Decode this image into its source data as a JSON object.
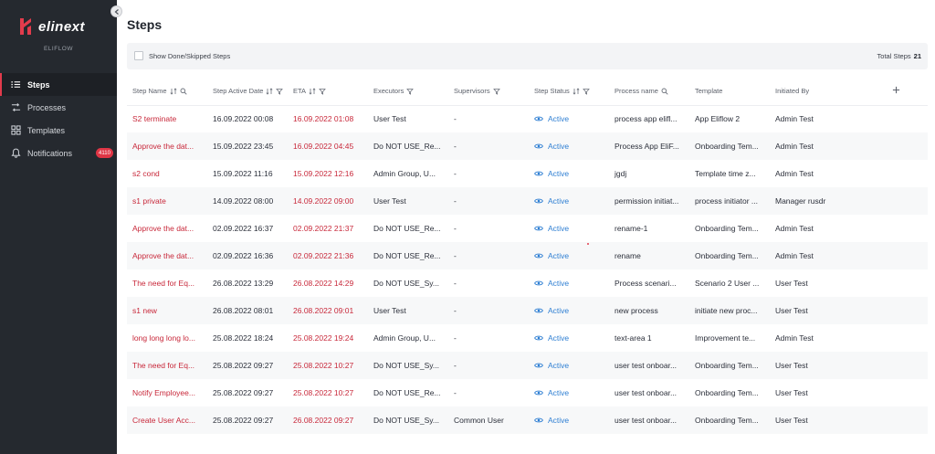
{
  "sidebar": {
    "logo_text": "elinext",
    "product": "ELIFLOW",
    "items": [
      {
        "label": "Steps",
        "icon": "list-icon",
        "active": true
      },
      {
        "label": "Processes",
        "icon": "process-icon"
      },
      {
        "label": "Templates",
        "icon": "grid-icon"
      },
      {
        "label": "Notifications",
        "icon": "bell-icon",
        "badge": "4110"
      }
    ]
  },
  "page": {
    "title": "Steps"
  },
  "filter": {
    "show_done_label": "Show Done/Skipped Steps",
    "total_label": "Total Steps",
    "total_value": "21"
  },
  "colors": {
    "accent": "#e23b4c",
    "sidebar_bg": "#25292f",
    "link_red": "#c8283a",
    "status_blue": "#2f7fd3"
  },
  "table": {
    "headers": [
      "Step Name",
      "Step Active Date",
      "ETA",
      "Executors",
      "Supervisors",
      "Step Status",
      "Process name",
      "Template",
      "Initiated By"
    ],
    "rows": [
      [
        "S2 terminate",
        "16.09.2022 00:08",
        "16.09.2022 01:08",
        "User Test",
        "-",
        "Active",
        "process app elifl...",
        "App Eliflow 2",
        "Admin Test"
      ],
      [
        "Approve the dat...",
        "15.09.2022 23:45",
        "16.09.2022 04:45",
        "Do NOT USE_Re...",
        "-",
        "Active",
        "Process App EliF...",
        "Onboarding Tem...",
        "Admin Test"
      ],
      [
        "s2 cond",
        "15.09.2022 11:16",
        "15.09.2022 12:16",
        "Admin Group, U...",
        "-",
        "Active",
        "jgdj",
        "Template time z...",
        "Admin Test"
      ],
      [
        "s1 private",
        "14.09.2022 08:00",
        "14.09.2022 09:00",
        "User Test",
        "-",
        "Active",
        "permission initiat...",
        "process initiator ...",
        "Manager rusdr"
      ],
      [
        "Approve the dat...",
        "02.09.2022 16:37",
        "02.09.2022 21:37",
        "Do NOT USE_Re...",
        "-",
        "Active",
        "rename-1",
        "Onboarding Tem...",
        "Admin Test"
      ],
      [
        "Approve the dat...",
        "02.09.2022 16:36",
        "02.09.2022 21:36",
        "Do NOT USE_Re...",
        "-",
        "Active",
        "rename",
        "Onboarding Tem...",
        "Admin Test"
      ],
      [
        "The need for Eq...",
        "26.08.2022 13:29",
        "26.08.2022 14:29",
        "Do NOT USE_Sy...",
        "-",
        "Active",
        "Process scenari...",
        "Scenario 2 User ...",
        "User Test"
      ],
      [
        "s1 new",
        "26.08.2022 08:01",
        "26.08.2022 09:01",
        "User Test",
        "-",
        "Active",
        "new process",
        "initiate new proc...",
        "User Test"
      ],
      [
        "long long long lo...",
        "25.08.2022 18:24",
        "25.08.2022 19:24",
        "Admin Group, U...",
        "-",
        "Active",
        "text-area 1",
        "Improvement te...",
        "Admin Test"
      ],
      [
        "The need for Eq...",
        "25.08.2022 09:27",
        "25.08.2022 10:27",
        "Do NOT USE_Sy...",
        "-",
        "Active",
        "user test onboar...",
        "Onboarding Tem...",
        "User Test"
      ],
      [
        "Notify Employee...",
        "25.08.2022 09:27",
        "25.08.2022 10:27",
        "Do NOT USE_Re...",
        "-",
        "Active",
        "user test onboar...",
        "Onboarding Tem...",
        "User Test"
      ],
      [
        "Create User Acc...",
        "25.08.2022 09:27",
        "26.08.2022 09:27",
        "Do NOT USE_Sy...",
        "Common User",
        "Active",
        "user test onboar...",
        "Onboarding Tem...",
        "User Test"
      ]
    ]
  }
}
